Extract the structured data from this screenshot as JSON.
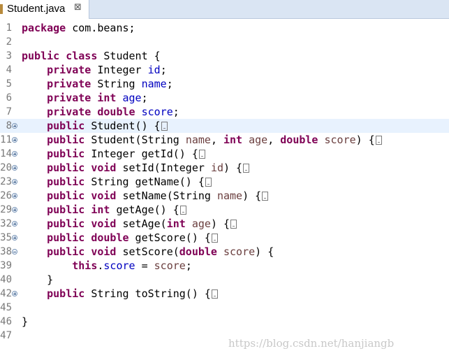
{
  "tab": {
    "title": "Student.java",
    "close_glyph": "⊠",
    "file_icon": "java-file-icon"
  },
  "editor": {
    "highlighted_line": "8",
    "lines": [
      {
        "num": "1",
        "fold": "",
        "t": [
          [
            "package",
            "kw"
          ],
          [
            " com.beans;",
            ""
          ]
        ]
      },
      {
        "num": "2",
        "fold": "",
        "t": []
      },
      {
        "num": "3",
        "fold": "",
        "t": [
          [
            "public",
            "kw"
          ],
          [
            " ",
            ""
          ],
          [
            "class",
            "kw"
          ],
          [
            " Student {",
            ""
          ]
        ]
      },
      {
        "num": "4",
        "fold": "",
        "t": [
          [
            "    ",
            ""
          ],
          [
            "private",
            "kw"
          ],
          [
            " Integer ",
            ""
          ],
          [
            "id",
            "fld"
          ],
          [
            ";",
            ""
          ]
        ]
      },
      {
        "num": "5",
        "fold": "",
        "t": [
          [
            "    ",
            ""
          ],
          [
            "private",
            "kw"
          ],
          [
            " String ",
            ""
          ],
          [
            "name",
            "fld"
          ],
          [
            ";",
            ""
          ]
        ]
      },
      {
        "num": "6",
        "fold": "",
        "t": [
          [
            "    ",
            ""
          ],
          [
            "private",
            "kw"
          ],
          [
            " ",
            ""
          ],
          [
            "int",
            "kw"
          ],
          [
            " ",
            ""
          ],
          [
            "age",
            "fld"
          ],
          [
            ";",
            ""
          ]
        ]
      },
      {
        "num": "7",
        "fold": "",
        "t": [
          [
            "    ",
            ""
          ],
          [
            "private",
            "kw"
          ],
          [
            " ",
            ""
          ],
          [
            "double",
            "kw"
          ],
          [
            " ",
            ""
          ],
          [
            "score",
            "fld"
          ],
          [
            ";",
            ""
          ]
        ]
      },
      {
        "num": "8",
        "fold": "plus",
        "t": [
          [
            "    ",
            ""
          ],
          [
            "public",
            "kw"
          ],
          [
            " Student() {",
            ""
          ],
          [
            "",
            "box"
          ]
        ]
      },
      {
        "num": "11",
        "fold": "plus",
        "t": [
          [
            "    ",
            ""
          ],
          [
            "public",
            "kw"
          ],
          [
            " Student(String ",
            ""
          ],
          [
            "name",
            "par"
          ],
          [
            ", ",
            ""
          ],
          [
            "int",
            "kw"
          ],
          [
            " ",
            ""
          ],
          [
            "age",
            "par"
          ],
          [
            ", ",
            ""
          ],
          [
            "double",
            "kw"
          ],
          [
            " ",
            ""
          ],
          [
            "score",
            "par"
          ],
          [
            ") {",
            ""
          ],
          [
            "",
            "box"
          ]
        ]
      },
      {
        "num": "14",
        "fold": "plus",
        "t": [
          [
            "    ",
            ""
          ],
          [
            "public",
            "kw"
          ],
          [
            " Integer getId() {",
            ""
          ],
          [
            "",
            "box"
          ]
        ]
      },
      {
        "num": "20",
        "fold": "plus",
        "t": [
          [
            "    ",
            ""
          ],
          [
            "public",
            "kw"
          ],
          [
            " ",
            ""
          ],
          [
            "void",
            "kw"
          ],
          [
            " setId(Integer ",
            ""
          ],
          [
            "id",
            "par"
          ],
          [
            ") {",
            ""
          ],
          [
            "",
            "box"
          ]
        ]
      },
      {
        "num": "23",
        "fold": "plus",
        "t": [
          [
            "    ",
            ""
          ],
          [
            "public",
            "kw"
          ],
          [
            " String getName() {",
            ""
          ],
          [
            "",
            "box"
          ]
        ]
      },
      {
        "num": "26",
        "fold": "plus",
        "t": [
          [
            "    ",
            ""
          ],
          [
            "public",
            "kw"
          ],
          [
            " ",
            ""
          ],
          [
            "void",
            "kw"
          ],
          [
            " setName(String ",
            ""
          ],
          [
            "name",
            "par"
          ],
          [
            ") {",
            ""
          ],
          [
            "",
            "box"
          ]
        ]
      },
      {
        "num": "29",
        "fold": "plus",
        "t": [
          [
            "    ",
            ""
          ],
          [
            "public",
            "kw"
          ],
          [
            " ",
            ""
          ],
          [
            "int",
            "kw"
          ],
          [
            " getAge() {",
            ""
          ],
          [
            "",
            "box"
          ]
        ]
      },
      {
        "num": "32",
        "fold": "plus",
        "t": [
          [
            "    ",
            ""
          ],
          [
            "public",
            "kw"
          ],
          [
            " ",
            ""
          ],
          [
            "void",
            "kw"
          ],
          [
            " setAge(",
            ""
          ],
          [
            "int",
            "kw"
          ],
          [
            " ",
            ""
          ],
          [
            "age",
            "par"
          ],
          [
            ") {",
            ""
          ],
          [
            "",
            "box"
          ]
        ]
      },
      {
        "num": "35",
        "fold": "plus",
        "t": [
          [
            "    ",
            ""
          ],
          [
            "public",
            "kw"
          ],
          [
            " ",
            ""
          ],
          [
            "double",
            "kw"
          ],
          [
            " getScore() {",
            ""
          ],
          [
            "",
            "box"
          ]
        ]
      },
      {
        "num": "38",
        "fold": "minus",
        "t": [
          [
            "    ",
            ""
          ],
          [
            "public",
            "kw"
          ],
          [
            " ",
            ""
          ],
          [
            "void",
            "kw"
          ],
          [
            " setScore(",
            ""
          ],
          [
            "double",
            "kw"
          ],
          [
            " ",
            ""
          ],
          [
            "score",
            "par"
          ],
          [
            ") {",
            ""
          ]
        ]
      },
      {
        "num": "39",
        "fold": "",
        "t": [
          [
            "        ",
            ""
          ],
          [
            "this",
            "kw"
          ],
          [
            ".",
            ""
          ],
          [
            "score",
            "fld"
          ],
          [
            " = ",
            ""
          ],
          [
            "score",
            "par"
          ],
          [
            ";",
            ""
          ]
        ]
      },
      {
        "num": "40",
        "fold": "",
        "t": [
          [
            "    }",
            ""
          ]
        ]
      },
      {
        "num": "42",
        "fold": "plus",
        "t": [
          [
            "    ",
            ""
          ],
          [
            "public",
            "kw"
          ],
          [
            " String toString() {",
            ""
          ],
          [
            "",
            "box"
          ]
        ]
      },
      {
        "num": "45",
        "fold": "",
        "t": []
      },
      {
        "num": "46",
        "fold": "",
        "t": [
          [
            "}",
            ""
          ]
        ]
      },
      {
        "num": "47",
        "fold": "",
        "t": []
      }
    ]
  },
  "watermark": "https://blog.csdn.net/hanjiangb"
}
